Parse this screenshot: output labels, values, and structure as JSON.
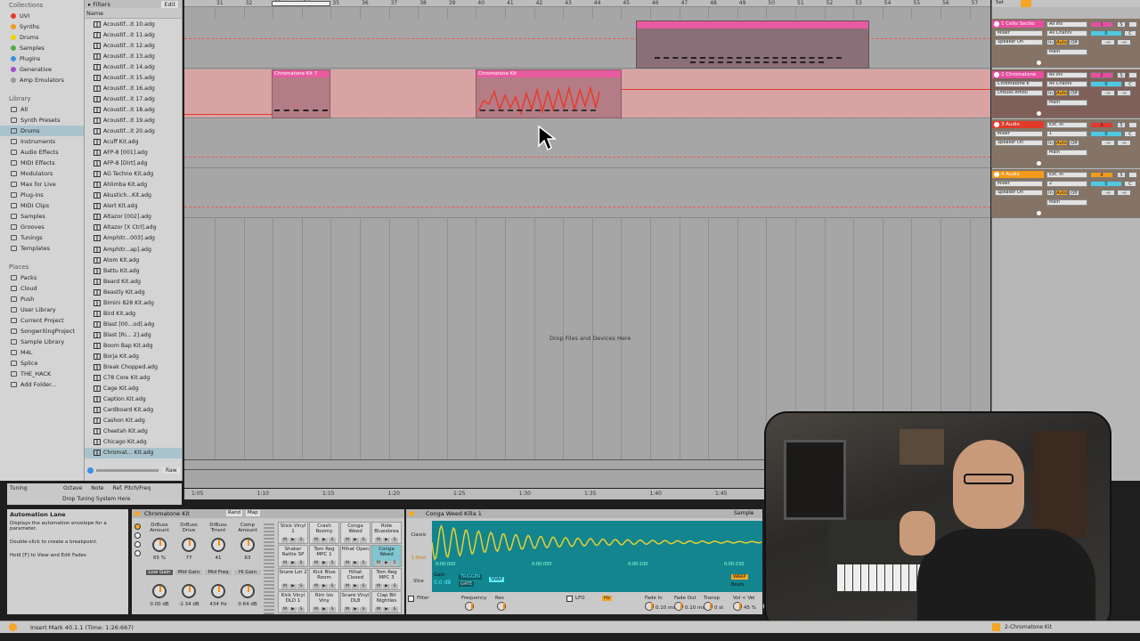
{
  "collections": {
    "header": "Collections",
    "items": [
      {
        "label": "UVI",
        "color": "#e83a2c"
      },
      {
        "label": "Synths",
        "color": "#f39a1b"
      },
      {
        "label": "Drums",
        "color": "#f0d400"
      },
      {
        "label": "Samples",
        "color": "#4cb050"
      },
      {
        "label": "Plugins",
        "color": "#3a8fe0"
      },
      {
        "label": "Generative",
        "color": "#a050d0"
      },
      {
        "label": "Amp Emulators",
        "color": "#999999"
      }
    ]
  },
  "library": {
    "header": "Library",
    "items": [
      "All",
      "Synth Presets",
      "Drums",
      "Instruments",
      "Audio Effects",
      "MIDI Effects",
      "Modulators",
      "Max for Live",
      "Plug-ins",
      "MIDI Clips",
      "Samples",
      "Grooves",
      "Tunings",
      "Templates"
    ],
    "selected": "Drums"
  },
  "places": {
    "header": "Places",
    "items": [
      "Packs",
      "Cloud",
      "Push",
      "User Library",
      "Current Project",
      "SongwritingProject",
      "Sample Library",
      "M4L",
      "Splice",
      "THE_HACK",
      "Add Folder..."
    ]
  },
  "file_browser": {
    "filters_label": "Filters",
    "edit_label": "Edit",
    "column_name": "Name",
    "raw_label": "Raw",
    "items": [
      "Acoustif...it 10.adg",
      "Acoustif...it 11.adg",
      "Acoustif...it 12.adg",
      "Acoustif...it 13.adg",
      "Acoustif...it 14.adg",
      "Acoustif...it 15.adg",
      "Acoustif...it 16.adg",
      "Acoustif...it 17.adg",
      "Acoustif...it 18.adg",
      "Acoustif...it 19.adg",
      "Acoustif...it 20.adg",
      "Acuff Kit.adg",
      "AFP-8 [001].adg",
      "AFP-8 [Dirt].adg",
      "AG Techno Kit.adg",
      "Ahlimba Kit.adg",
      "Akustich...Kit.adg",
      "Alert Kit.adg",
      "Altazor [002].adg",
      "Altazor [X Ctrl].adg",
      "Amphitr...003].adg",
      "Amphitr...ap].adg",
      "Atom Kit.adg",
      "Battu Kit.adg",
      "Beard Kit.adg",
      "Beastly Kit.adg",
      "Bimini 828 Kit.adg",
      "Bird Kit.adg",
      "Blast [00...od].adg",
      "Blast [Ri... 2].adg",
      "Boom Bap Kit.adg",
      "Borja Kit.adg",
      "Break Chopped.adg",
      "C78 Core Kit.adg",
      "Cage Kit.adg",
      "Caption Kit.adg",
      "Cardboard Kit.adg",
      "Cashon Kit.adg",
      "Cheetah Kit.adg",
      "Chicago Kit.adg",
      "Chromat... Kit.adg"
    ],
    "selected": "Chromat... Kit.adg"
  },
  "arrangement": {
    "bars": [
      "31",
      "32",
      "33",
      "34",
      "35",
      "36",
      "37",
      "38",
      "39",
      "40",
      "41",
      "42",
      "43",
      "44",
      "45",
      "46",
      "47",
      "48",
      "49",
      "50",
      "51",
      "52",
      "53",
      "54",
      "55",
      "56",
      "57"
    ],
    "time_labels": [
      "1:05",
      "1:10",
      "1:15",
      "1:20",
      "1:25",
      "1:30",
      "1:35",
      "1:40",
      "1:45"
    ],
    "drop_hint": "Drop Files and Devices Here",
    "clips": [
      {
        "name": "Chromatone Kit 7",
        "color": "#e75ba0"
      },
      {
        "name": "Chromatone Kit",
        "color": "#e75ba0"
      },
      {
        "name": "",
        "color": "#e75ba0"
      }
    ]
  },
  "mixer": {
    "tracks": [
      {
        "name": "1 Cello Sectio",
        "color": "#e64fa0",
        "input": "All Ins",
        "channel": "All Channi",
        "device": "Mixer",
        "out": "Speaker On",
        "main": "Main",
        "number": "1"
      },
      {
        "name": "2 Chromatone",
        "color": "#e64fa0",
        "input": "All Ins",
        "channel": "All Channi",
        "device": "Chromatone K",
        "device2": "DrBuss Amou",
        "main": "Main",
        "number": "2"
      },
      {
        "name": "3 Audio",
        "color": "#e03a2a",
        "input": "Ext. In",
        "channel": "1",
        "device": "Mixer",
        "out": "Speaker On",
        "main": "Main",
        "number": "3"
      },
      {
        "name": "4 Audio",
        "color": "#f29a1b",
        "input": "Ext. In",
        "channel": "2",
        "device": "Mixer",
        "out": "Speaker On",
        "main": "Main",
        "number": "4"
      }
    ],
    "in_label": "In",
    "auto_label": "Auto",
    "off_label": "Off",
    "zero_label": "0",
    "s_label": "S",
    "c_label": "C",
    "inf_label": "-∞"
  },
  "tuning": {
    "label": "Tuning",
    "columns": [
      "Octave",
      "Note",
      "Ref. Pitch/Freq"
    ],
    "action": "Drop Tuning System Here"
  },
  "info_view": {
    "title": "Automation Lane",
    "lines": [
      "Displays the automation envelope for a parameter.",
      "Double-click to create a breakpoint.",
      "Hold [F] to View and Edit Fades"
    ]
  },
  "drum_rack": {
    "title": "Chromatone Kit",
    "rand_label": "Rand",
    "map_label": "Map",
    "macros_top": [
      {
        "label": "DrBuss Amount",
        "value": "65 %"
      },
      {
        "label": "DrBuss Drive",
        "value": "77"
      },
      {
        "label": "DrBuss Trnsnt",
        "value": "41"
      },
      {
        "label": "Comp Amount",
        "value": "63"
      }
    ],
    "macros_bottom": [
      {
        "label": "Low Gain",
        "value": "0.00 dB"
      },
      {
        "label": "Mid Gain",
        "value": "-2.34 dB"
      },
      {
        "label": "Mid Freq",
        "value": "434 Hz"
      },
      {
        "label": "Hi Gain",
        "value": "0.64 dB"
      }
    ],
    "pads": [
      "Stick Vinyl 1",
      "Crash Roomy",
      "Conga Weed",
      "Ride Bluesbrea",
      "Shaker Rattle SP",
      "Tom Reg MPC 1",
      "Hihat Open",
      "Conga Weed",
      "Snare Lot 2",
      "Kick Blue Room",
      "Hihat Closed",
      "Tom Reg MPC 3",
      "Kick Vinyl DLD 1",
      "Rim Izo Viny",
      "Snare Vinyl DL8",
      "Clap Bit Nighties"
    ],
    "selected_pad": 7,
    "pad_buttons": [
      "M",
      "▶",
      "S"
    ]
  },
  "simpler": {
    "title": "Conga Weed Killa 1",
    "sample_label": "Sample",
    "modes": [
      "Classic",
      "1-Shot",
      "Slice"
    ],
    "gain_label": "Gain",
    "gain_value": "0.0 dB",
    "trigger_label": "TRIGGER",
    "gate_label": "GATE",
    "snap_label": "SNAP",
    "warp_label": "WARP",
    "beats_label": "Beats",
    "time_marks": [
      "0:00:000",
      "0:00:050",
      "0:00:100",
      "0:00:150"
    ],
    "filter_label": "Filter",
    "freq_label": "Frequency",
    "res_label": "Res",
    "lfo_label": "LFO",
    "hz_label": "Hz",
    "params": [
      {
        "label": "Fade In",
        "value": "0.10 ms"
      },
      {
        "label": "Fade Out",
        "value": "0.10 ms"
      },
      {
        "label": "Transp",
        "value": "0 st"
      },
      {
        "label": "Vol < Vel",
        "value": "45 %"
      },
      {
        "label": "Vol",
        "value": "-12.0 dB"
      }
    ],
    "waveform_color": "#e8d033"
  },
  "status": {
    "message": "Insert Mark 40.1.1 (Time: 1:26:667)",
    "track_label": "2-Chromatone Kit"
  },
  "webcam": {
    "description_label": "Presenter webcam"
  }
}
